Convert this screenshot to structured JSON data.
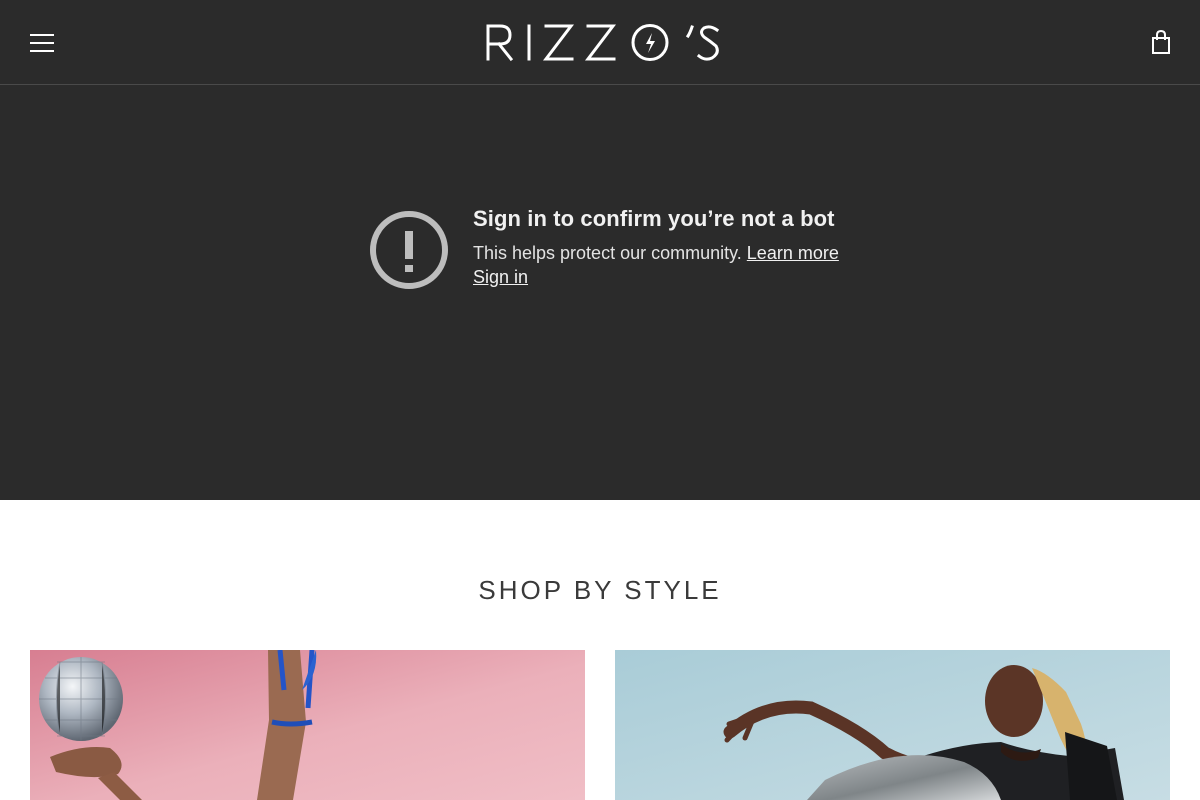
{
  "header": {
    "menu_icon": "hamburger-menu-icon",
    "logo_text": "RIZZO’S",
    "cart_icon": "shopping-bag-icon",
    "background": "#2b2b2b"
  },
  "video_notice": {
    "icon": "exclamation-circle-icon",
    "title": "Sign in to confirm you’re not a bot",
    "message": "This helps protect our community.",
    "learn_more": "Learn more",
    "sign_in": "Sign in"
  },
  "shop_by_style": {
    "title": "SHOP BY STYLE",
    "cards": [
      {
        "name": "style-card-party",
        "background": "#e2a0a8"
      },
      {
        "name": "style-card-lounge",
        "background": "#b7d3dc"
      }
    ]
  }
}
